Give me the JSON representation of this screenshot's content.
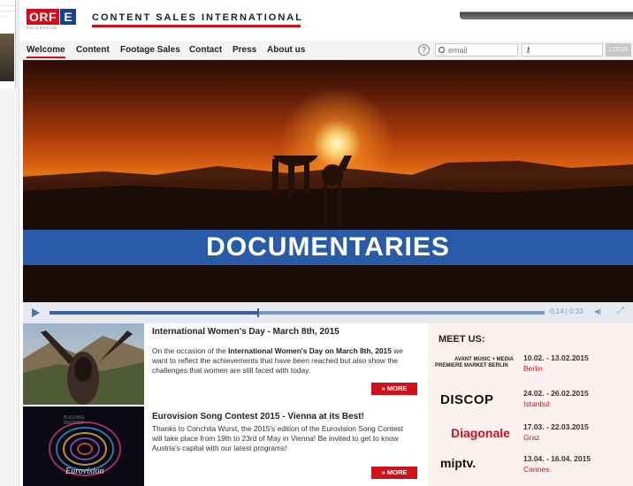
{
  "site": {
    "logo": {
      "text": "ORF",
      "letter": "E",
      "subtitle": "ENTERPRISE"
    },
    "title": "CONTENT SALES INTERNATIONAL"
  },
  "nav": {
    "items": [
      "Welcome",
      "Content",
      "Footage Sales",
      "Contact",
      "Press",
      "About us"
    ],
    "active": "Welcome"
  },
  "login": {
    "email_placeholder": "email",
    "button_label": "LOGIN"
  },
  "hero": {
    "banner": "DOCUMENTARIES"
  },
  "video": {
    "time": "0:14 | 0:33",
    "progress": 0.42
  },
  "news": [
    {
      "title": "International Women's Day - March 8th, 2015",
      "body_1": "On the occasion of the ",
      "body_bold_1": "International Women's Day on March 8th, 2015",
      "body_2": " we want to reflect the achievements that have been reached but also show the challenges that women are still faced with today.",
      "more": "MORE"
    },
    {
      "title": "Eurovision Song Contest 2015 - Vienna at its Best!",
      "body": "Thanks to Conchita Wurst, the 2015's edition of the Eurovision Song Contest will take place from 19th to 23rd of May in Vienna! Be invited to get to know Austria's capital with our latest programs!",
      "more": "MORE",
      "image_text": "Eurovision"
    }
  ],
  "events": {
    "title": "MEET US:",
    "items": [
      {
        "logo_line1": "AVANT MUSIC + MEDIA",
        "logo_line2": "PREMIERE MARKET BERLIN",
        "dates": "10.02. - 13.02.2015",
        "city": "Berlin"
      },
      {
        "logo": "DISCOP",
        "dates": "24.02. - 26.02.2015",
        "city": "Istanbul"
      },
      {
        "logo": "Diagonale",
        "dates": "17.03. - 22.03.2015",
        "city": "Graz"
      },
      {
        "logo": "miptv.",
        "dates": "13.04. - 16.04. 2015",
        "city": "Cannes"
      }
    ]
  },
  "colors": {
    "brand_red": "#d0101b",
    "brand_blue": "#17428a",
    "banner_blue": "#2a5ba6"
  }
}
